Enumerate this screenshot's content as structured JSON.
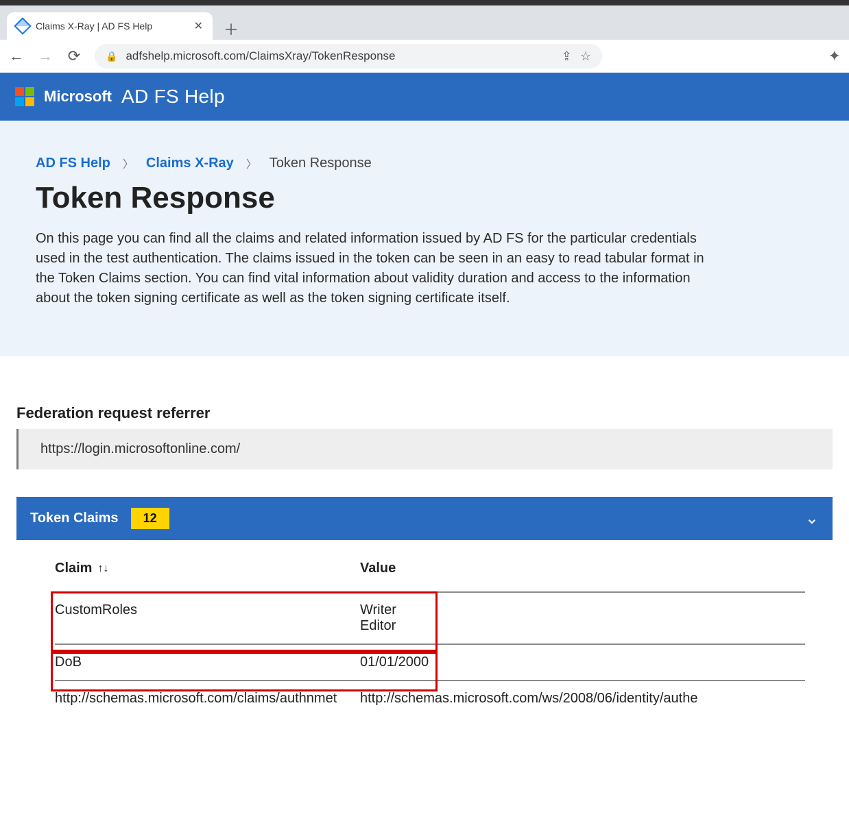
{
  "browser": {
    "tab_title": "Claims X-Ray | AD FS Help",
    "url": "adfshelp.microsoft.com/ClaimsXray/TokenResponse"
  },
  "header": {
    "brand": "Microsoft",
    "product": "AD FS Help"
  },
  "breadcrumb": {
    "items": [
      "AD FS Help",
      "Claims X-Ray"
    ],
    "current": "Token Response"
  },
  "page": {
    "title": "Token Response",
    "description": "On this page you can find all the claims and related information issued by AD FS for the particular credentials used in the test authentication. The claims issued in the token can be seen in an easy to read tabular format in the Token Claims section. You can find vital information about validity duration and access to the information about the token signing certificate as well as the token signing certificate itself."
  },
  "referrer": {
    "label": "Federation request referrer",
    "value": "https://login.microsoftonline.com/"
  },
  "token_claims": {
    "panel_title": "Token Claims",
    "count": "12",
    "columns": {
      "claim": "Claim",
      "value": "Value"
    },
    "rows": [
      {
        "claim": "CustomRoles",
        "value": "Writer\nEditor"
      },
      {
        "claim": "DoB",
        "value": "01/01/2000"
      },
      {
        "claim": "http://schemas.microsoft.com/claims/authnmet",
        "value": "http://schemas.microsoft.com/ws/2008/06/identity/authe"
      }
    ]
  }
}
